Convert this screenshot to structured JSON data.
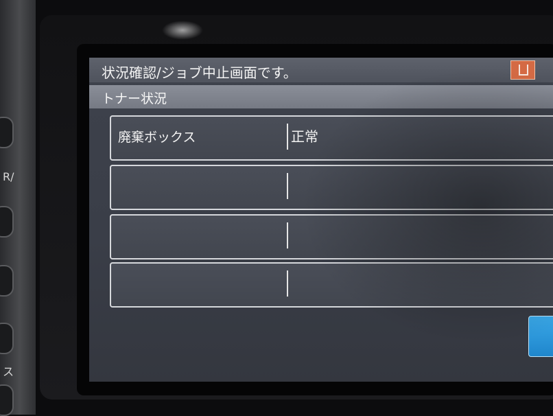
{
  "device": {
    "side_glyphs": [
      "R/",
      "ス"
    ]
  },
  "screen": {
    "status_message": "状況確認/ジョブ中止画面です。",
    "section_title": "トナー状況",
    "rows": [
      {
        "label": "廃棄ボックス",
        "value": "正常"
      },
      {
        "label": "",
        "value": ""
      },
      {
        "label": "",
        "value": ""
      },
      {
        "label": "",
        "value": ""
      }
    ]
  }
}
